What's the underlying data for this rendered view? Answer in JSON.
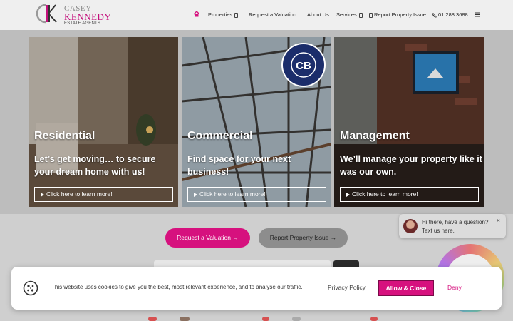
{
  "brand": {
    "line1": "CASEY",
    "line2": "KENNEDY",
    "line3": "ESTATE AGENTS",
    "accent": "#d6117e"
  },
  "nav": {
    "home_icon": "home-icon",
    "items": [
      "Properties",
      "Request a Valuation",
      "About Us",
      "Services"
    ],
    "report": "Report Property Issue",
    "phone": "01 288 3688",
    "menu_icon": "hamburger-icon"
  },
  "cards": [
    {
      "title": "Residential",
      "desc": "Let’s get moving… to secure your dream home with us!",
      "button": "Click here to learn more!"
    },
    {
      "title": "Commercial",
      "desc": "Find space for your next business!",
      "button": "Click here to learn more!"
    },
    {
      "title": "Management",
      "desc": "We’ll manage your property like it was our own.",
      "button": "Click here to learn more!"
    }
  ],
  "cta": {
    "valuation": "Request a Valuation →",
    "report": "Report Property Issue →"
  },
  "chat": {
    "line1": "Hi there, have a question?",
    "line2": "Text us here.",
    "close": "×"
  },
  "cookie": {
    "text": "This website uses cookies to give you the best, most relevant experience, and to analyse our traffic.",
    "privacy": "Privacy Policy",
    "allow": "Allow & Close",
    "deny": "Deny"
  }
}
